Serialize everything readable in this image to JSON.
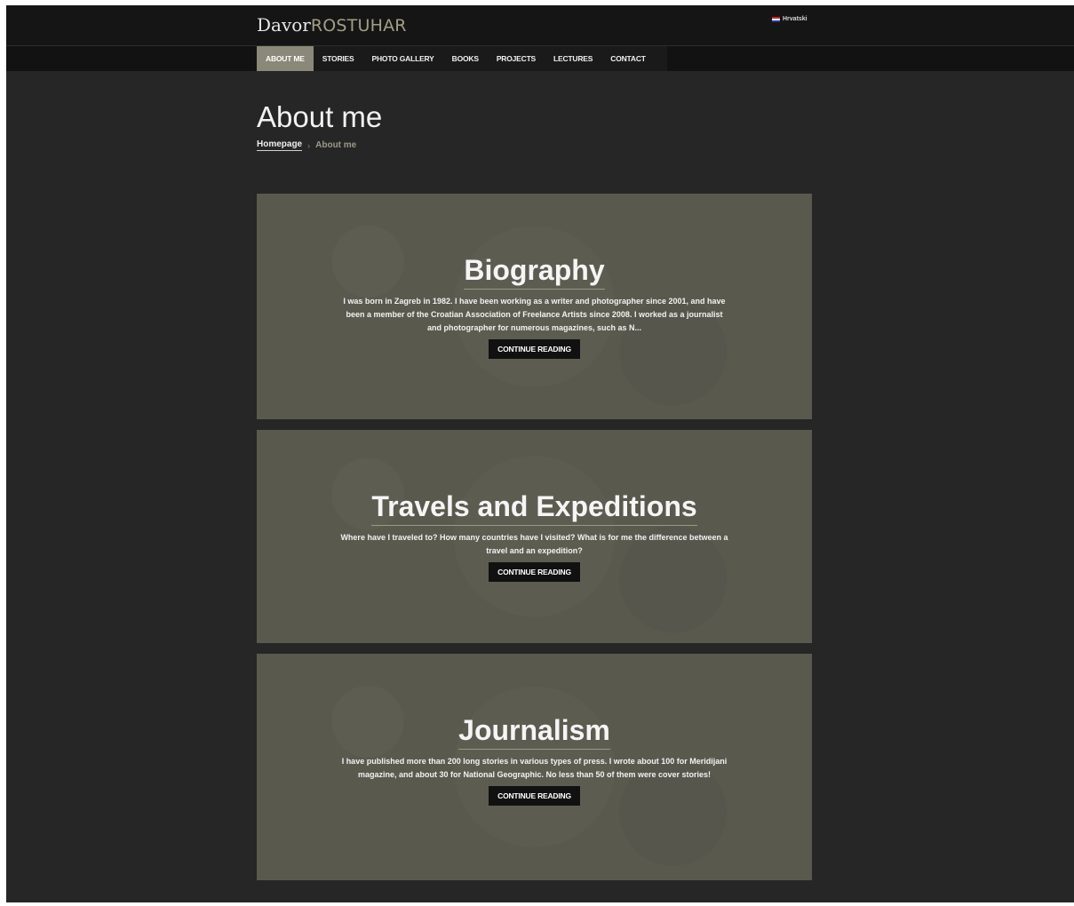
{
  "header": {
    "logo_first": "Davor",
    "logo_last": "ROSTUHAR",
    "language": {
      "label": "Hrvatski",
      "flag": "croatia-flag-icon"
    }
  },
  "nav": {
    "items": [
      {
        "label": "ABOUT ME",
        "active": true
      },
      {
        "label": "STORIES",
        "active": false
      },
      {
        "label": "PHOTO GALLERY",
        "active": false
      },
      {
        "label": "BOOKS",
        "active": false
      },
      {
        "label": "PROJECTS",
        "active": false
      },
      {
        "label": "LECTURES",
        "active": false
      },
      {
        "label": "CONTACT",
        "active": false
      }
    ]
  },
  "page": {
    "title": "About me",
    "breadcrumb": {
      "home": "Homepage",
      "separator": "›",
      "current": "About me"
    }
  },
  "cards": [
    {
      "title": "Biography",
      "text": "I was born in Zagreb in 1982. I have been working as a writer and photographer since 2001, and have been a member of the Croatian Association of Freelance Artists since 2008. I worked as a journalist and photographer for numerous magazines, such as N...",
      "button": "CONTINUE READING"
    },
    {
      "title": "Travels and Expeditions",
      "text": "Where have I traveled to? How many countries have I visited? What is for me the difference between a travel and an expedition?",
      "button": "CONTINUE READING"
    },
    {
      "title": "Journalism",
      "text": "I have published more than 200 long stories in various types of press. I wrote about 100 for Meridijani magazine, and about 30 for National Geographic. No less than 50 of them were cover stories!",
      "button": "CONTINUE READING"
    }
  ],
  "colors": {
    "accent": "#8a8878",
    "background": "#262626",
    "card": "#5a594e",
    "topbar": "#151515"
  }
}
